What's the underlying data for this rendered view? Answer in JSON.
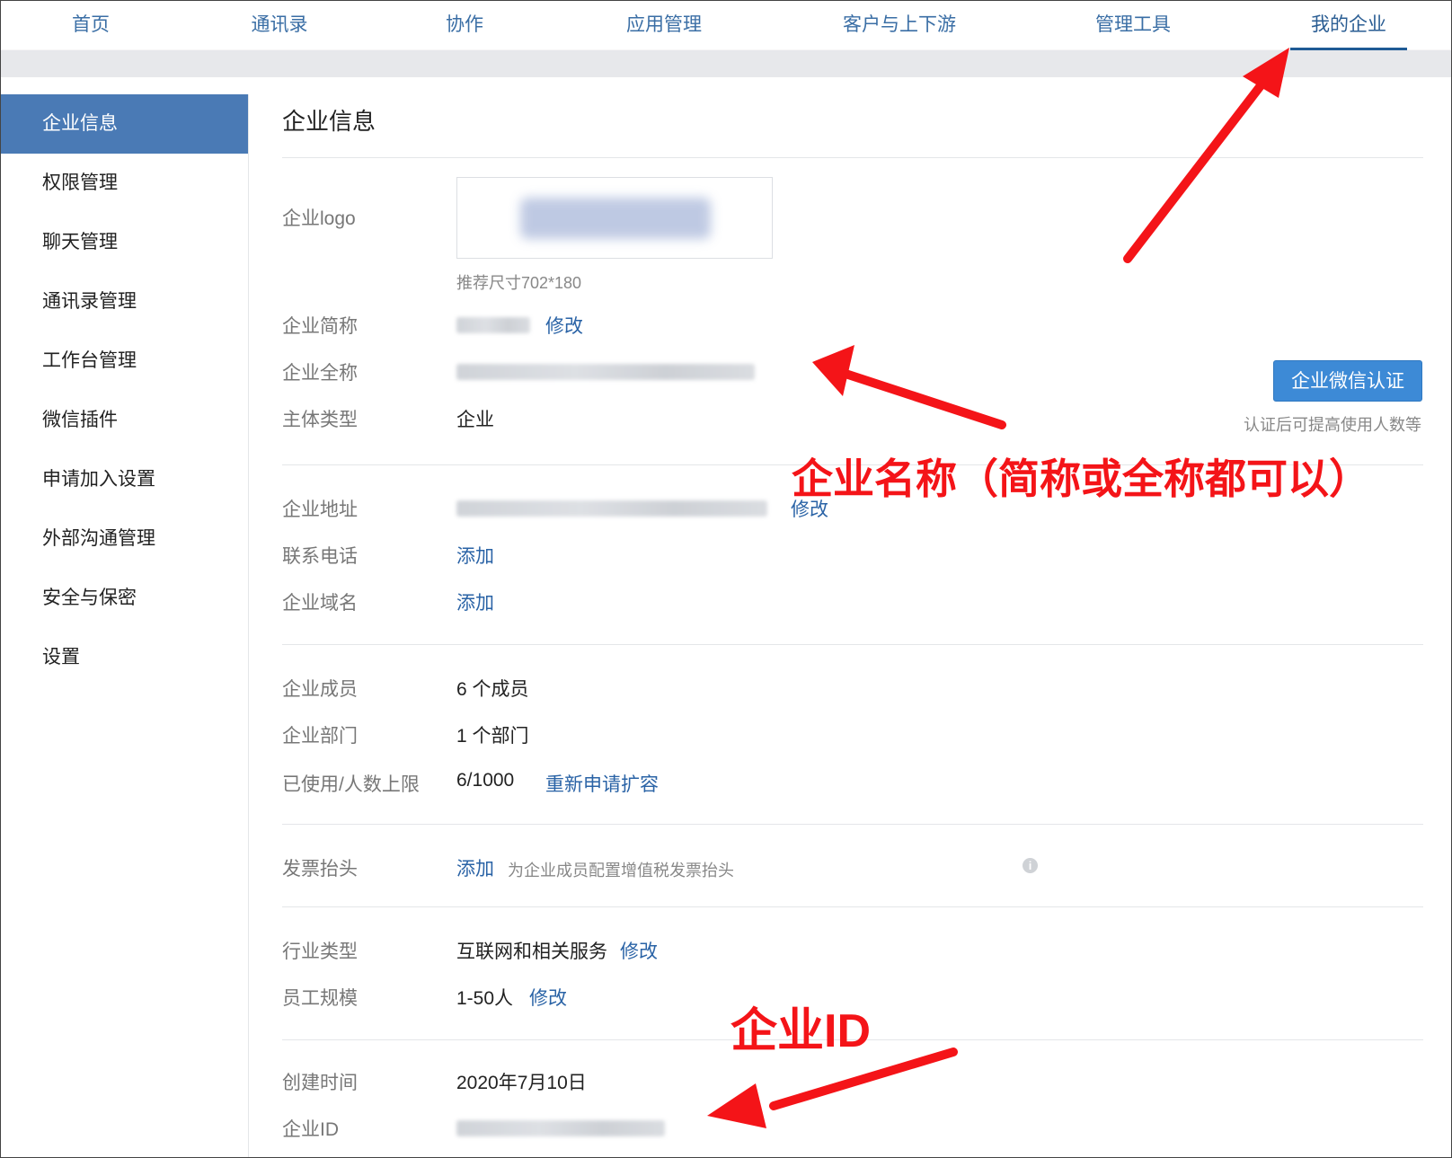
{
  "topnav": {
    "tabs": [
      {
        "label": "首页"
      },
      {
        "label": "通讯录"
      },
      {
        "label": "协作"
      },
      {
        "label": "应用管理"
      },
      {
        "label": "客户与上下游"
      },
      {
        "label": "管理工具"
      },
      {
        "label": "我的企业"
      }
    ],
    "active": "我的企业"
  },
  "sidebar": {
    "items": [
      {
        "label": "企业信息"
      },
      {
        "label": "权限管理"
      },
      {
        "label": "聊天管理"
      },
      {
        "label": "通讯录管理"
      },
      {
        "label": "工作台管理"
      },
      {
        "label": "微信插件"
      },
      {
        "label": "申请加入设置"
      },
      {
        "label": "外部沟通管理"
      },
      {
        "label": "安全与保密"
      },
      {
        "label": "设置"
      }
    ],
    "active": "企业信息"
  },
  "main": {
    "title": "企业信息",
    "logo": {
      "label": "企业logo",
      "hint": "推荐尺寸702*180"
    },
    "short_name": {
      "label": "企业简称",
      "edit": "修改"
    },
    "full_name": {
      "label": "企业全称"
    },
    "entity_type": {
      "label": "主体类型",
      "value": "企业"
    },
    "auth": {
      "button": "企业微信认证",
      "hint": "认证后可提高使用人数等"
    },
    "address": {
      "label": "企业地址",
      "edit": "修改"
    },
    "phone": {
      "label": "联系电话",
      "add": "添加"
    },
    "domain": {
      "label": "企业域名",
      "add": "添加"
    },
    "members": {
      "label": "企业成员",
      "value": "6 个成员"
    },
    "departments": {
      "label": "企业部门",
      "value": "1 个部门"
    },
    "usage": {
      "label": "已使用/人数上限",
      "value": "6/1000",
      "link": "重新申请扩容"
    },
    "invoice": {
      "label": "发票抬头",
      "add": "添加",
      "hint": "为企业成员配置增值税发票抬头",
      "info_icon": "i"
    },
    "industry": {
      "label": "行业类型",
      "value": "互联网和相关服务",
      "edit": "修改"
    },
    "staff_size": {
      "label": "员工规模",
      "value": "1-50人",
      "edit": "修改"
    },
    "created": {
      "label": "创建时间",
      "value": "2020年7月10日"
    },
    "corp_id": {
      "label": "企业ID"
    }
  },
  "annotations": {
    "name_note": "企业名称（简称或全称都可以）",
    "id_note": "企业ID",
    "color": "#f41418"
  }
}
